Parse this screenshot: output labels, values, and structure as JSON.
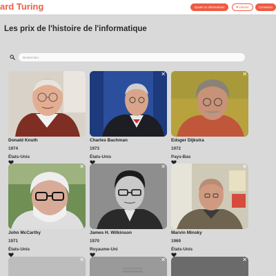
{
  "header": {
    "brand": "ard Turing",
    "add_button": "Ajouter un informaticien",
    "favorites_button": "Informé",
    "login_button": "Connexion"
  },
  "page": {
    "title": "Les prix de l'histoire de l'informatique"
  },
  "search": {
    "placeholder": "Rechercher",
    "value": ""
  },
  "laureates": [
    {
      "name": "Donald Knuth",
      "year": "1974",
      "country": "États-Unis"
    },
    {
      "name": "Charles Bachman",
      "year": "1973",
      "country": "États-Unis"
    },
    {
      "name": "Edsger Dijkstra",
      "year": "1972",
      "country": "Pays-Bas"
    },
    {
      "name": "John McCarthy",
      "year": "1971",
      "country": "États-Unis"
    },
    {
      "name": "James H. Wilkinson",
      "year": "1970",
      "country": "Royaume-Uni"
    },
    {
      "name": "Marvin Minsky",
      "year": "1969",
      "country": "États-Unis"
    }
  ],
  "icons": {
    "close": "close-icon",
    "favorite": "heart-icon",
    "search": "search-icon"
  },
  "colors": {
    "accent": "#ef5b41",
    "background": "#d9d9d9"
  }
}
